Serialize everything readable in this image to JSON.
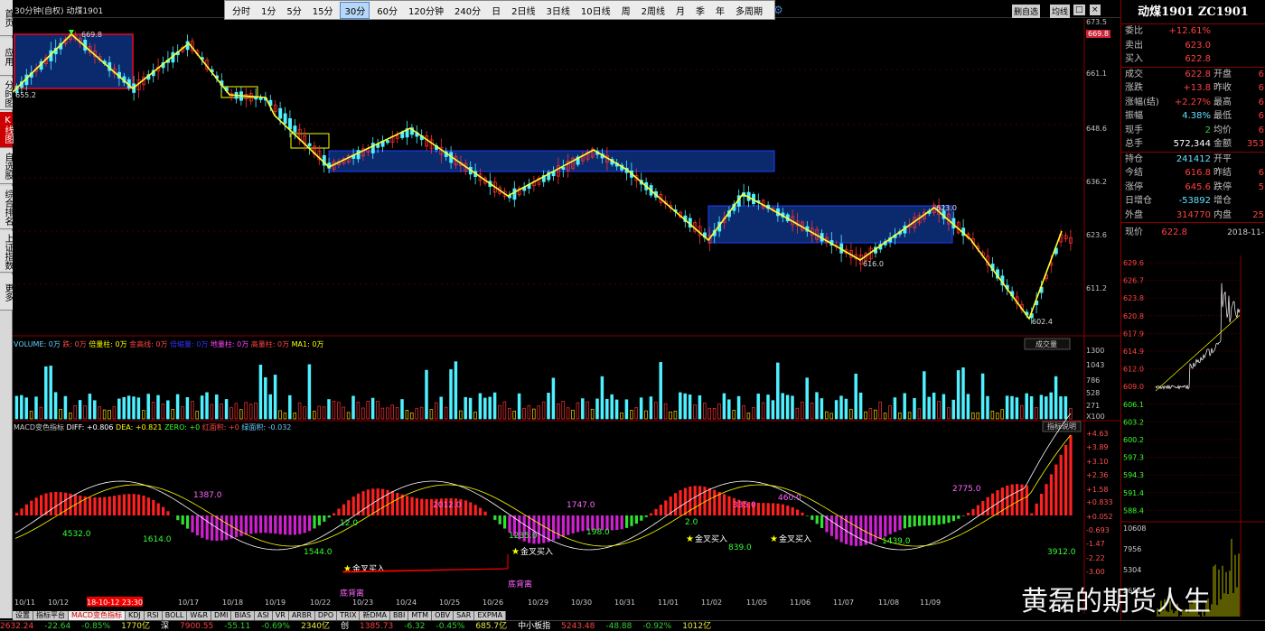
{
  "window": {
    "title": "30分钟(自权)  动煤1901"
  },
  "sidebar": [
    "首页",
    "应用",
    "分时图",
    "K线图",
    "自选股",
    "综合排名",
    "上证指数",
    "更多"
  ],
  "periods": [
    "分时",
    "1分",
    "5分",
    "15分",
    "30分",
    "60分",
    "120分钟",
    "240分",
    "日",
    "2日线",
    "3日线",
    "10日线",
    "周",
    "2周线",
    "月",
    "季",
    "年",
    "多周期"
  ],
  "selected_period": "30分",
  "toolbar_buttons": {
    "self": "删自选",
    "avg": "均线",
    "restore": "□",
    "close": "×"
  },
  "price_axis": [
    "673.5",
    "669.8",
    "661.1",
    "648.6",
    "636.2",
    "623.6",
    "611.2"
  ],
  "volume_axis": [
    "1300",
    "1043",
    "786",
    "528",
    "271",
    "X100"
  ],
  "macd_axis": [
    "+4.63",
    "+3.89",
    "+3.10",
    "+2.36",
    "+1.58",
    "+0.833",
    "+0.052",
    "-0.693",
    "-1.47",
    "-2.22",
    "-3.00"
  ],
  "price_labels": {
    "high1": "669.8",
    "low1": "655.2",
    "low2": "616.0",
    "high2": "623.0",
    "low3": "602.4"
  },
  "volume_header": {
    "vol": "VOLUME: 0万",
    "a": "跌: 0万",
    "b": "倍量柱: 0万",
    "c": "金高线: 0万",
    "d": "倍缩量: 0万",
    "e": "地量柱: 0万",
    "f": "高量柱: 0万",
    "g": "MA1: 0万",
    "btn": "成交量"
  },
  "macd_header": {
    "name": "MACD变色指标",
    "diff": "DIFF: +0.806",
    "dea": "DEA: +0.821",
    "zero": "ZERO: +0",
    "red": "红面积: +0",
    "green": "绿面积: -0.032",
    "btn": "指标说明"
  },
  "macd_labels": [
    "1387.0",
    "4532.0",
    "1614.0",
    "1544.0",
    "2012.0",
    "1747.0",
    "2775.0",
    "3912.0",
    "12.0",
    "335.0",
    "460.0",
    "198.0",
    "839.0",
    "1439.0",
    "1235.0",
    "2.0"
  ],
  "signals": [
    "金叉买入",
    "金叉买入",
    "金叉买入",
    "金叉买入"
  ],
  "divergence": [
    "底背离",
    "底背离"
  ],
  "xaxis": [
    "10/11",
    "10/12",
    "18-10-12 23:30",
    "10/17",
    "10/18",
    "10/19",
    "10/22",
    "10/23",
    "10/24",
    "10/25",
    "10/26",
    "10/29",
    "10/30",
    "10/31",
    "11/01",
    "11/02",
    "11/05",
    "11/06",
    "11/07",
    "11/08",
    "11/09"
  ],
  "quote": {
    "name": "动煤1901 ZC1901",
    "rows": [
      {
        "l": "委比",
        "v": "+12.61%",
        "c": "red",
        "l2": "",
        "v2": ""
      },
      {
        "l": "卖出",
        "v": "623.0",
        "c": "red",
        "l2": "",
        "v2": ""
      },
      {
        "l": "买入",
        "v": "622.8",
        "c": "red",
        "l2": "",
        "v2": ""
      },
      {
        "l": "成交",
        "v": "622.8",
        "c": "red",
        "l2": "开盘",
        "v2": "6"
      },
      {
        "l": "涨跌",
        "v": "+13.8",
        "c": "red",
        "l2": "昨收",
        "v2": "6"
      },
      {
        "l": "涨幅(结)",
        "v": "+2.27%",
        "c": "red",
        "l2": "最高",
        "v2": "6"
      },
      {
        "l": "振幅",
        "v": "4.38%",
        "c": "cyan",
        "l2": "最低",
        "v2": "6"
      },
      {
        "l": "现手",
        "v": "2",
        "c": "green",
        "l2": "均价",
        "v2": "6"
      },
      {
        "l": "总手",
        "v": "572,344",
        "c": "white",
        "l2": "金额",
        "v2": "353"
      },
      {
        "l": "持仓",
        "v": "241412",
        "c": "cyan",
        "l2": "开平",
        "v2": ""
      },
      {
        "l": "今结",
        "v": "616.8",
        "c": "red",
        "l2": "昨结",
        "v2": "6"
      },
      {
        "l": "涨停",
        "v": "645.6",
        "c": "red",
        "l2": "跌停",
        "v2": "5"
      },
      {
        "l": "日增仓",
        "v": "-53892",
        "c": "cyan",
        "l2": "增仓",
        "v2": ""
      },
      {
        "l": "外盘",
        "v": "314770",
        "c": "red",
        "l2": "内盘",
        "v2": "25"
      }
    ],
    "now_label": "现价",
    "now_value": "622.8",
    "date": "2018-11-"
  },
  "mini_axis": [
    "629.6",
    "626.7",
    "623.8",
    "620.8",
    "617.9",
    "614.9",
    "612.0",
    "609.0",
    "606.1",
    "603.2",
    "600.2",
    "597.3",
    "594.3",
    "591.4",
    "588.4",
    "10608",
    "7956",
    "5304",
    "2652"
  ],
  "bottom_tabs": [
    "设置",
    "指标平台",
    "MACD变色指标",
    "KDJ",
    "RSI",
    "BOLL",
    "W&R",
    "DMI",
    "BIAS",
    "ASI",
    "VR",
    "ARBR",
    "DPO",
    "TRIX",
    "新DMA",
    "BBI",
    "MTM",
    "OBV",
    "SAR",
    "EXPMA"
  ],
  "ticker": [
    {
      "t": "2632.24",
      "c": "red"
    },
    {
      "t": "-22.64",
      "c": "green"
    },
    {
      "t": "-0.85%",
      "c": "green"
    },
    {
      "t": "1770亿",
      "c": "yellow"
    },
    {
      "t": "深",
      "c": "white"
    },
    {
      "t": "7900.55",
      "c": "red"
    },
    {
      "t": "-55.11",
      "c": "green"
    },
    {
      "t": "-0.69%",
      "c": "green"
    },
    {
      "t": "2340亿",
      "c": "yellow"
    },
    {
      "t": "创",
      "c": "white"
    },
    {
      "t": "1385.73",
      "c": "red"
    },
    {
      "t": "-6.32",
      "c": "green"
    },
    {
      "t": "-0.45%",
      "c": "green"
    },
    {
      "t": "685.7亿",
      "c": "yellow"
    },
    {
      "t": "中小板指",
      "c": "white"
    },
    {
      "t": "5243.48",
      "c": "red"
    },
    {
      "t": "-48.88",
      "c": "green"
    },
    {
      "t": "-0.92%",
      "c": "green"
    },
    {
      "t": "1012亿",
      "c": "yellow"
    }
  ],
  "watermark": "黄磊的期货人生"
}
